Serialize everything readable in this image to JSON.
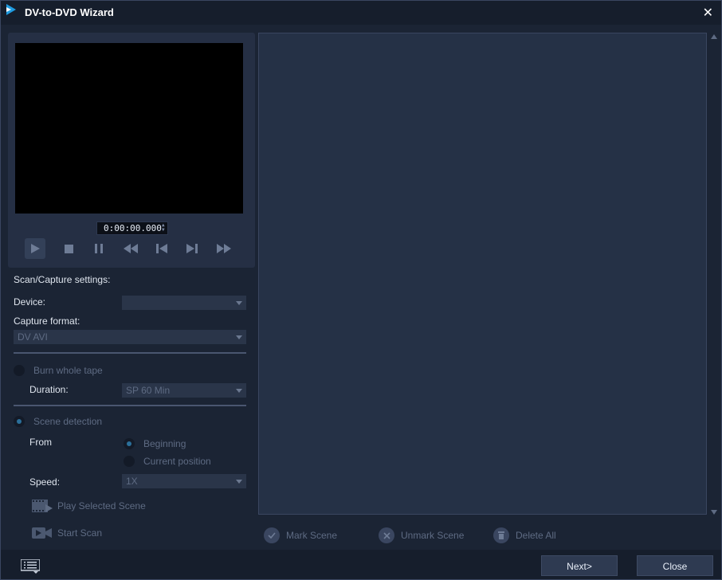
{
  "window": {
    "title": "DV-to-DVD Wizard"
  },
  "player": {
    "timecode": "0:00:00.000"
  },
  "settings": {
    "heading": "Scan/Capture settings:",
    "device_label": "Device:",
    "device_value": "",
    "capture_format_label": "Capture format:",
    "capture_format_value": "DV AVI",
    "burn_whole_tape": "Burn whole tape",
    "duration_label": "Duration:",
    "duration_value": "SP 60 Min",
    "scene_detection": "Scene detection",
    "from_label": "From",
    "from_options": [
      "Beginning",
      "Current position"
    ],
    "speed_label": "Speed:",
    "speed_value": "1X",
    "play_selected_scene": "Play Selected Scene",
    "start_scan": "Start Scan"
  },
  "scene_actions": {
    "mark": "Mark Scene",
    "unmark": "Unmark Scene",
    "delete_all": "Delete All"
  },
  "footer": {
    "next": "Next>",
    "close": "Close"
  },
  "colors": {
    "background": "#1b2434",
    "panel": "#253146",
    "accent": "#2b6f9a",
    "disabled_text": "#5e6b83"
  }
}
